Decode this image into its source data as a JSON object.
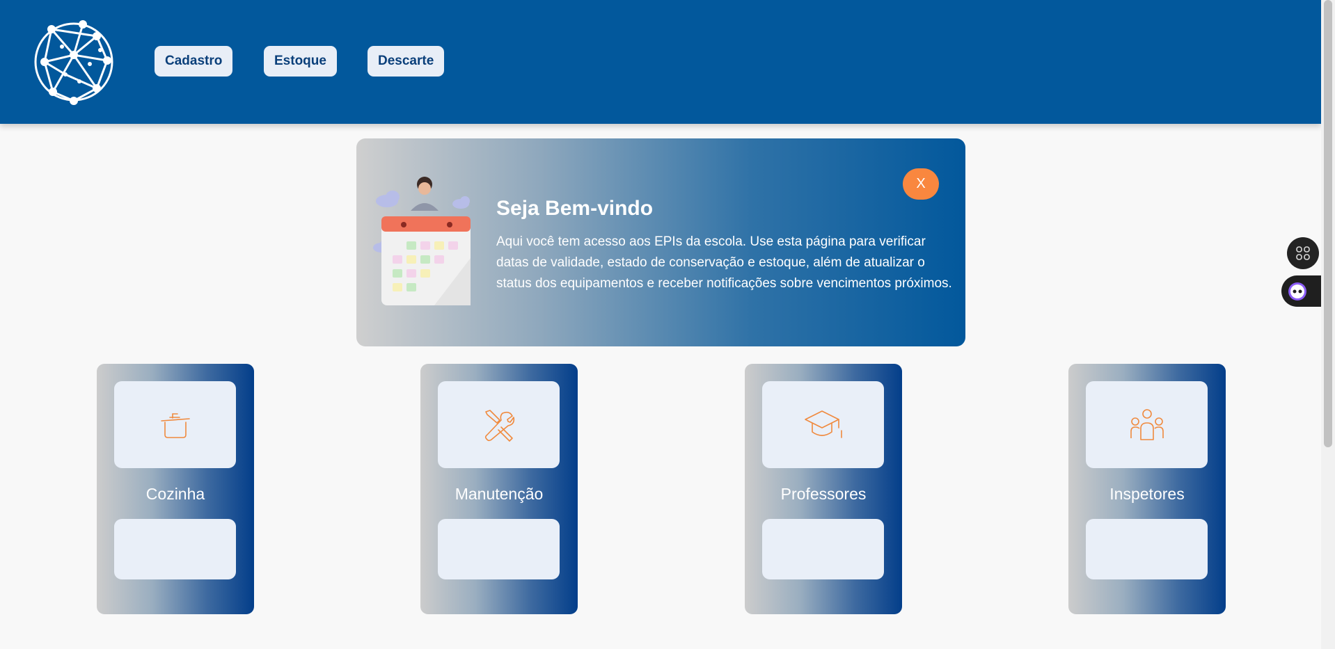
{
  "header": {
    "logo_icon": "network-globe-icon",
    "nav": [
      {
        "label": "Cadastro"
      },
      {
        "label": "Estoque"
      },
      {
        "label": "Descarte"
      }
    ]
  },
  "welcome": {
    "title": "Seja Bem-vindo",
    "text": "Aqui você tem acesso aos EPIs da escola. Use esta página para verificar datas de validade, estado de conservação e estoque, além de atualizar o status dos equipamentos e receber notificações sobre vencimentos próximos.",
    "close_label": "X",
    "illustration": "calendar-person-illustration"
  },
  "cards": [
    {
      "label": "Cozinha",
      "icon": "cooking-pot-icon"
    },
    {
      "label": "Manutenção",
      "icon": "wrench-screwdriver-icon"
    },
    {
      "label": "Professores",
      "icon": "graduation-cap-icon"
    },
    {
      "label": "Inspetores",
      "icon": "group-people-icon"
    }
  ],
  "colors": {
    "header": "#02589c",
    "accent": "#f9873f",
    "nav_button_bg": "#e8eef7",
    "nav_button_text": "#0a3f7a",
    "card_gradient_end": "#033e8a",
    "icon_stroke": "#f08a3e"
  },
  "floating": {
    "apps_icon": "command-grid-icon",
    "assistant_icon": "assistant-bot-icon"
  }
}
